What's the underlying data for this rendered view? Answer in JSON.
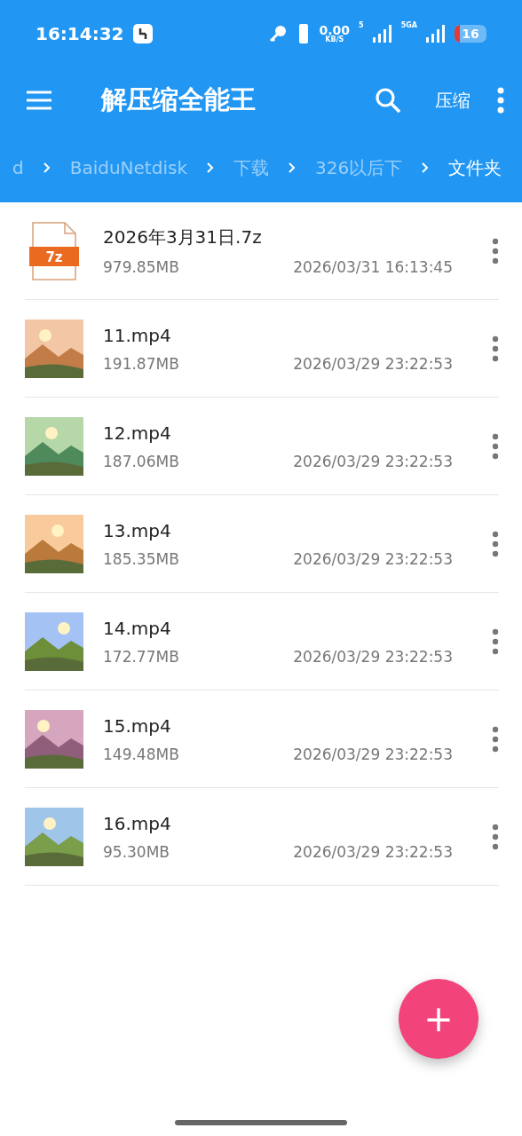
{
  "status_bar": {
    "time": "16:14:32",
    "speed": "0.00",
    "speed_unit": "KB/S",
    "sim1": "5",
    "sim2": "5GA",
    "battery": "16"
  },
  "app_bar": {
    "title": "解压缩全能王",
    "action": "压缩"
  },
  "breadcrumb": [
    {
      "label": "d",
      "selected": false
    },
    {
      "label": "BaiduNetdisk",
      "selected": false
    },
    {
      "label": "下载",
      "selected": false
    },
    {
      "label": "326以后下",
      "selected": false
    },
    {
      "label": "文件夹",
      "selected": true
    }
  ],
  "files": [
    {
      "kind": "archive",
      "badge": "7z",
      "name": "2026年3月31日.7z",
      "size": "979.85MB",
      "date": "2026/03/31 16:13:45"
    },
    {
      "kind": "video",
      "name": "11.mp4",
      "size": "191.87MB",
      "date": "2026/03/29 23:22:53"
    },
    {
      "kind": "video",
      "name": "12.mp4",
      "size": "187.06MB",
      "date": "2026/03/29 23:22:53"
    },
    {
      "kind": "video",
      "name": "13.mp4",
      "size": "185.35MB",
      "date": "2026/03/29 23:22:53"
    },
    {
      "kind": "video",
      "name": "14.mp4",
      "size": "172.77MB",
      "date": "2026/03/29 23:22:53"
    },
    {
      "kind": "video",
      "name": "15.mp4",
      "size": "149.48MB",
      "date": "2026/03/29 23:22:53"
    },
    {
      "kind": "video",
      "name": "16.mp4",
      "size": "95.30MB",
      "date": "2026/03/29 23:22:53"
    }
  ],
  "fab": {
    "label": "+"
  }
}
